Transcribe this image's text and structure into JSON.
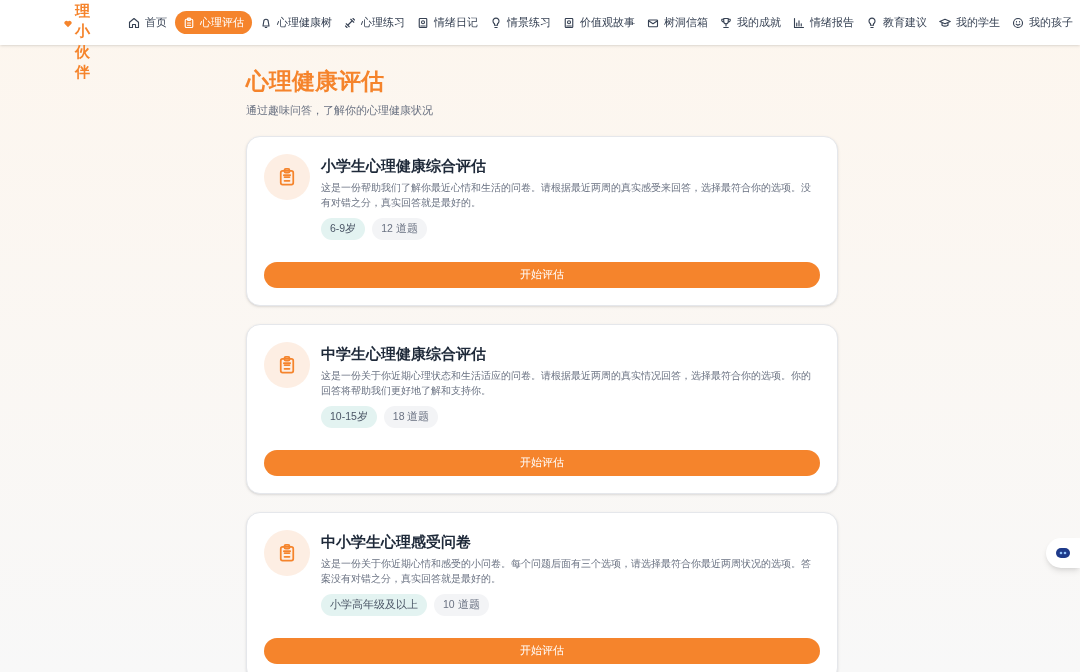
{
  "logo": {
    "text": "理小伙伴"
  },
  "nav": [
    {
      "label": "首页",
      "selected": false
    },
    {
      "label": "心理评估",
      "selected": true
    },
    {
      "label": "心理健康树",
      "selected": false
    },
    {
      "label": "心理练习",
      "selected": false
    },
    {
      "label": "情绪日记",
      "selected": false
    },
    {
      "label": "情景练习",
      "selected": false
    },
    {
      "label": "价值观故事",
      "selected": false
    },
    {
      "label": "树洞信箱",
      "selected": false
    },
    {
      "label": "我的成就",
      "selected": false
    },
    {
      "label": "情绪报告",
      "selected": false
    },
    {
      "label": "教育建议",
      "selected": false
    },
    {
      "label": "我的学生",
      "selected": false
    },
    {
      "label": "我的孩子",
      "selected": false
    }
  ],
  "page": {
    "title": "心理健康评估",
    "subtitle": "通过趣味问答，了解你的心理健康状况"
  },
  "assessments": [
    {
      "title": "小学生心理健康综合评估",
      "description": "这是一份帮助我们了解你最近心情和生活的问卷。请根据最近两周的真实感受来回答，选择最符合你的选项。没有对错之分，真实回答就是最好的。",
      "age": "6-9岁",
      "count": "12 道题",
      "button": "开始评估"
    },
    {
      "title": "中学生心理健康综合评估",
      "description": "这是一份关于你近期心理状态和生活适应的问卷。请根据最近两周的真实情况回答，选择最符合你的选项。你的回答将帮助我们更好地了解和支持你。",
      "age": "10-15岁",
      "count": "18 道题",
      "button": "开始评估"
    },
    {
      "title": "中小学生心理感受问卷",
      "description": "这是一份关于你近期心情和感受的小问卷。每个问题后面有三个选项，请选择最符合你最近两周状况的选项。答案没有对错之分，真实回答就是最好的。",
      "age": "小学高年级及以上",
      "count": "10 道题",
      "button": "开始评估"
    }
  ]
}
